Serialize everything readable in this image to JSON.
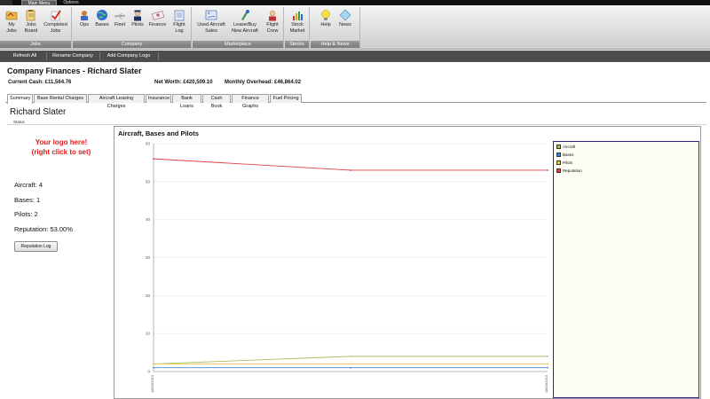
{
  "ribbon": {
    "tabs": [
      {
        "label": "Main Menu",
        "active": true
      },
      {
        "label": "Options",
        "active": false
      }
    ],
    "groups": [
      {
        "label": "Jobs",
        "buttons": [
          {
            "label": "My\nJobs",
            "icon": "folder-icon"
          },
          {
            "label": "Jobs\nBoard",
            "icon": "jobs-board-icon"
          },
          {
            "label": "Completed\nJobs",
            "icon": "checkmark-icon"
          }
        ]
      },
      {
        "label": "Company",
        "buttons": [
          {
            "label": "Ops",
            "icon": "operations-icon"
          },
          {
            "label": "Bases",
            "icon": "globe-icon"
          },
          {
            "label": "Fleet",
            "icon": "airplane-icon"
          },
          {
            "label": "Pilots",
            "icon": "pilot-icon"
          },
          {
            "label": "Finance",
            "icon": "finance-icon"
          },
          {
            "label": "Flight\nLog",
            "icon": "logbook-icon"
          }
        ]
      },
      {
        "label": "Marketplace",
        "buttons": [
          {
            "label": "Used Aircraft\nSales",
            "icon": "aircraft-sales-icon"
          },
          {
            "label": "Lease/Buy\nNew Aircraft",
            "icon": "lease-aircraft-icon"
          },
          {
            "label": "Flight\nCrew",
            "icon": "crew-icon"
          }
        ]
      },
      {
        "label": "Stocks",
        "buttons": [
          {
            "label": "Stock\nMarket",
            "icon": "stock-market-icon"
          }
        ]
      },
      {
        "label": "Help & News",
        "buttons": [
          {
            "label": "Help",
            "icon": "lightbulb-icon"
          },
          {
            "label": "News",
            "icon": "news-icon"
          }
        ]
      }
    ]
  },
  "toolbar": {
    "refresh_all": "Refresh All",
    "rename_company": "Rename Company",
    "add_company_logo": "Add Company Logo"
  },
  "page": {
    "title": "Company Finances - Richard Slater",
    "current_cash": "Current Cash: £11,564.76",
    "net_worth": "Net Worth: £420,509.10",
    "monthly_overhead": "Monthly Overhead: £46,864.02"
  },
  "subtabs": [
    {
      "label": "Summary",
      "active": true
    },
    {
      "label": "Base Rental Charges",
      "active": false
    },
    {
      "label": "Aircraft Leasing Charges",
      "active": false
    },
    {
      "label": "Insurance",
      "active": false
    },
    {
      "label": "Bank Loans",
      "active": false
    },
    {
      "label": "Cash Book",
      "active": false
    },
    {
      "label": "Finance Graphs",
      "active": false
    },
    {
      "label": "Fuel Pricing",
      "active": false
    }
  ],
  "summary": {
    "owner_name": "Richard Slater",
    "status_label": "Status",
    "logo_placeholder_line1": "Your logo here!",
    "logo_placeholder_line2": "(right click to set)",
    "aircraft": "Aircraft: 4",
    "bases": "Bases: 1",
    "pilots": "Pilots: 2",
    "reputation": "Reputation: 53.00%",
    "reputation_log_button": "Reputation Log"
  },
  "colors": {
    "aircraft": "#a8c060",
    "bases": "#4a86c8",
    "pilots": "#e8c850",
    "reputation": "#e04040"
  },
  "chart_data": {
    "type": "line",
    "title": "Aircraft, Bases and Pilots",
    "x": [
      "18/03/2013",
      "",
      "18/03/2013"
    ],
    "ylim": [
      0,
      60
    ],
    "yticks": [
      0,
      10,
      20,
      30,
      40,
      50,
      60
    ],
    "grid": true,
    "legend": "right",
    "series": [
      {
        "name": "Aircraft",
        "color": "#a8c060",
        "values": [
          2,
          4,
          4
        ]
      },
      {
        "name": "Bases",
        "color": "#4a86c8",
        "values": [
          1,
          1,
          1
        ]
      },
      {
        "name": "Pilots",
        "color": "#e8c850",
        "values": [
          2,
          2,
          2
        ]
      },
      {
        "name": "Reputation",
        "color": "#e04040",
        "values": [
          56,
          53,
          53
        ]
      }
    ]
  }
}
